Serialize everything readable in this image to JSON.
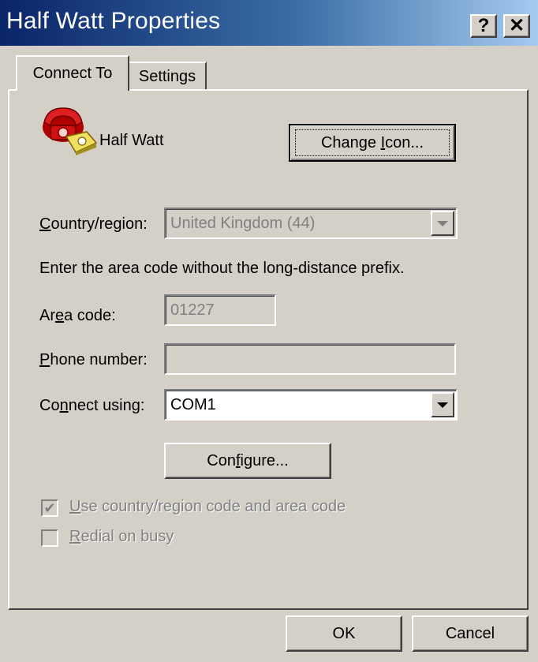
{
  "window": {
    "title": "Half Watt Properties",
    "help_glyph": "?",
    "close_glyph": "✕"
  },
  "tabs": [
    {
      "label": "Connect To",
      "active": true
    },
    {
      "label": "Settings",
      "active": false
    }
  ],
  "connection": {
    "name": "Half Watt",
    "change_icon_pre": "Change ",
    "change_icon_key": "I",
    "change_icon_post": "con..."
  },
  "country": {
    "label_key": "C",
    "label_rest": "ountry/region:",
    "value": "United Kingdom (44)",
    "enabled": false
  },
  "instruction": "Enter the area code without the long-distance prefix.",
  "area_code": {
    "label_pre": "Ar",
    "label_key": "e",
    "label_post": "a code:",
    "value": "01227",
    "enabled": false
  },
  "phone": {
    "label_key": "P",
    "label_rest": "hone number:",
    "value": "",
    "enabled": false
  },
  "connect_using": {
    "label_pre": "Co",
    "label_key": "n",
    "label_post": "nect using:",
    "value": "COM1"
  },
  "configure": {
    "pre": "Con",
    "key": "f",
    "post": "igure..."
  },
  "checkboxes": [
    {
      "key": "U",
      "rest": "se country/region code and area code",
      "checked": true,
      "enabled": false
    },
    {
      "key": "R",
      "rest": "edial on busy",
      "checked": false,
      "enabled": false
    }
  ],
  "buttons": {
    "ok": "OK",
    "cancel": "Cancel"
  },
  "colors": {
    "face": "#d4d0c8",
    "title_start": "#0a246a",
    "title_end": "#a6caf0"
  },
  "icons": {
    "connection": "red-telephone-icon"
  }
}
